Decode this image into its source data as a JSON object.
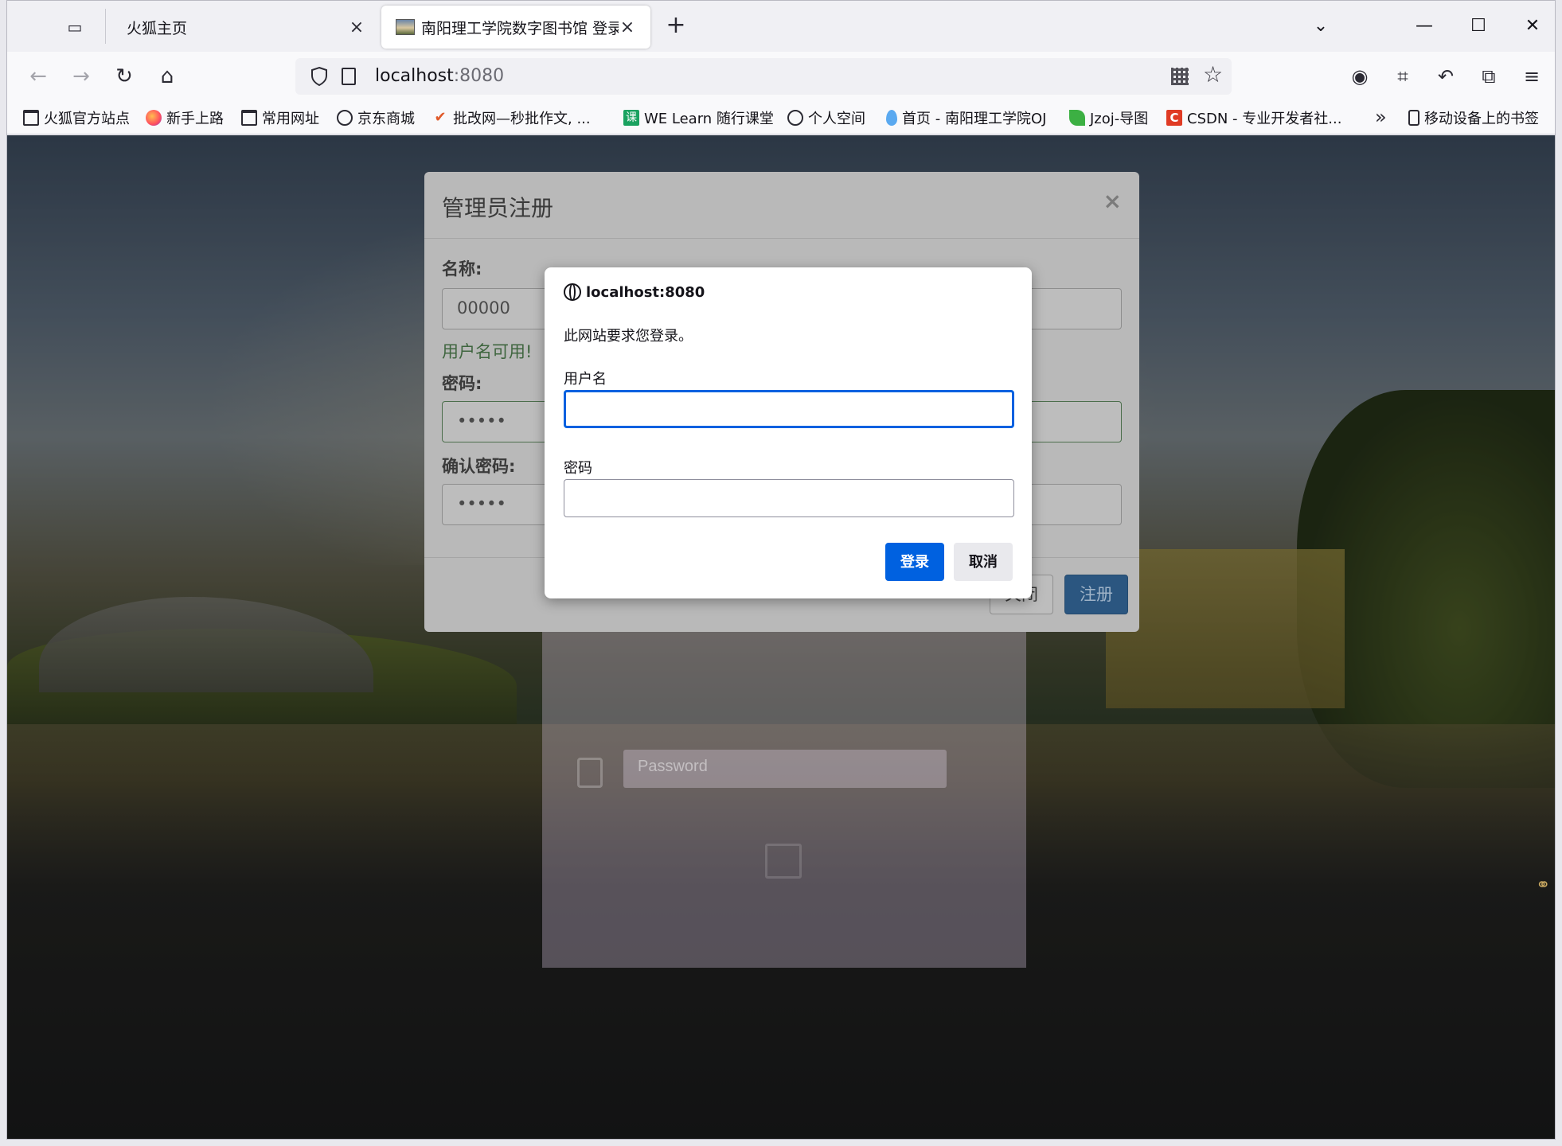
{
  "browser": {
    "tabs": [
      {
        "label": "火狐主页",
        "active": false
      },
      {
        "label": "南阳理工学院数字图书馆 登录",
        "active": true
      }
    ],
    "url": {
      "host": "localhost",
      "port": ":8080"
    },
    "bookmarks": [
      {
        "label": "火狐官方站点",
        "icon": "folder-icon"
      },
      {
        "label": "新手上路",
        "icon": "firefox-icon"
      },
      {
        "label": "常用网址",
        "icon": "folder-icon"
      },
      {
        "label": "京东商城",
        "icon": "globe-icon"
      },
      {
        "label": "批改网—秒批作文, ...",
        "icon": "check-icon"
      },
      {
        "label": "WE Learn 随行课堂",
        "icon": "ke-icon"
      },
      {
        "label": "个人空间",
        "icon": "globe-icon"
      },
      {
        "label": "首页 - 南阳理工学院OJ",
        "icon": "drop-icon"
      },
      {
        "label": "Jzoj-导图",
        "icon": "leaf-icon"
      },
      {
        "label": "CSDN - 专业开发者社...",
        "icon": "csdn-icon"
      },
      {
        "label": "移动设备上的书签",
        "icon": "phone-icon"
      }
    ]
  },
  "registration_modal": {
    "title": "管理员注册",
    "name_label": "名称:",
    "name_value": "00000",
    "name_ok_msg": "用户名可用!",
    "password_label": "密码:",
    "password_value": "•••••",
    "confirm_label": "确认密码:",
    "confirm_value": "•••••",
    "close_button": "关闭",
    "submit_button": "注册",
    "close_x": "×"
  },
  "login_card": {
    "password_placeholder": "Password"
  },
  "auth_dialog": {
    "origin": "localhost:8080",
    "message": "此网站要求您登录。",
    "username_label": "用户名",
    "username_value": "",
    "password_label": "密码",
    "password_value": "",
    "login_button": "登录",
    "cancel_button": "取消"
  },
  "colors": {
    "accent_blue": "#0061e0",
    "submit_dim": "#2b5680",
    "success_green": "#3e653e"
  }
}
